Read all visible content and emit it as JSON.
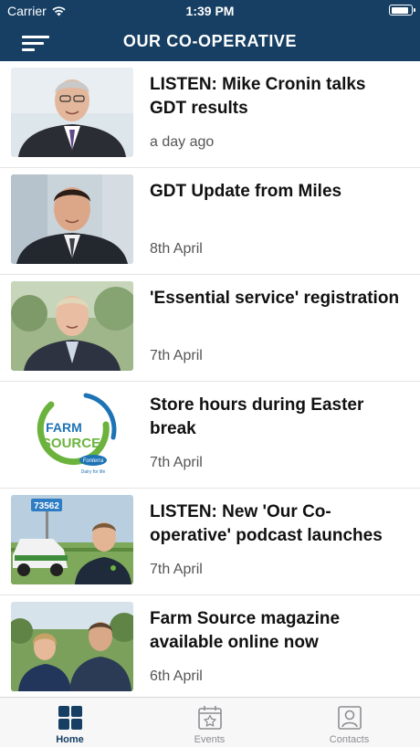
{
  "status_bar": {
    "carrier": "Carrier",
    "time": "1:39 PM",
    "battery_level": 0.9
  },
  "nav": {
    "title": "OUR CO-OPERATIVE",
    "menu_icon": "hamburger-icon"
  },
  "articles": [
    {
      "title": "LISTEN: Mike Cronin talks GDT results",
      "date": "a day ago"
    },
    {
      "title": "GDT Update from Miles",
      "date": "8th April"
    },
    {
      "title": "'Essential service' registration",
      "date": "7th April"
    },
    {
      "title": "Store hours during Easter break",
      "date": "7th April"
    },
    {
      "title": "LISTEN: New 'Our Co-operative' podcast launches",
      "date": "7th April"
    },
    {
      "title": "Farm Source magazine available online now",
      "date": "6th April"
    }
  ],
  "logo": {
    "line1": "FARM",
    "line2": "SOURCE",
    "brand": "Fonterra",
    "tagline": "Dairy for life"
  },
  "photo_text": {
    "sign_number": "73562"
  },
  "tabs": [
    {
      "label": "Home",
      "icon": "home-grid-icon",
      "active": true
    },
    {
      "label": "Events",
      "icon": "calendar-star-icon",
      "active": false
    },
    {
      "label": "Contacts",
      "icon": "contact-card-icon",
      "active": false
    }
  ],
  "colors": {
    "header": "#163f63",
    "active_tab": "#163f63",
    "inactive_tab": "#8e8e93"
  }
}
